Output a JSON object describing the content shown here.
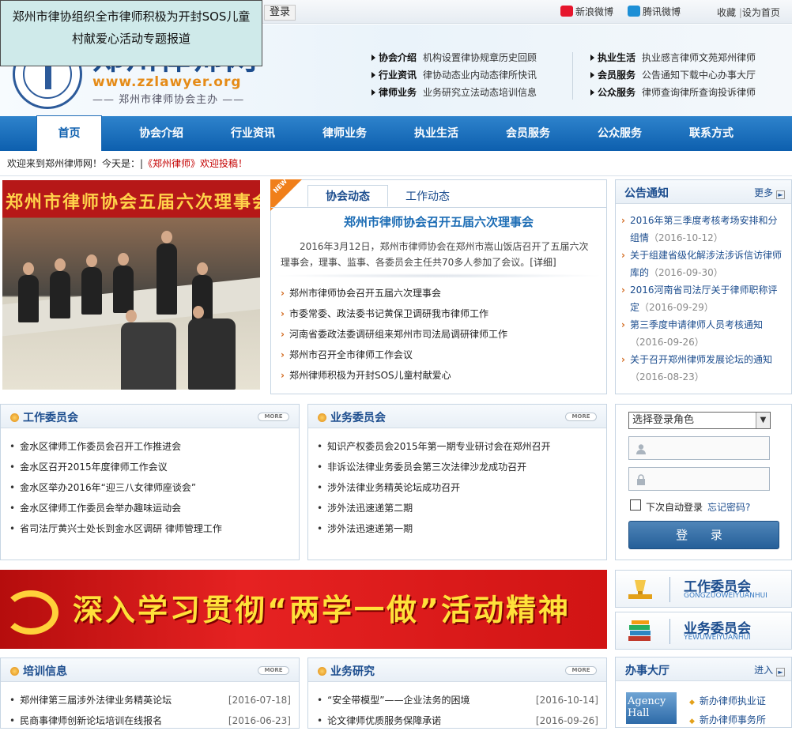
{
  "popup": {
    "text": "郑州市律协组织全市律师积极为开封SOS儿童村献爱心活动专题报道"
  },
  "topbar": {
    "login": "登录",
    "sina_weibo": "新浪微博",
    "tencent_weibo": "腾讯微博",
    "favorite": "收藏",
    "set_home": "设为首页",
    "separator": "|"
  },
  "logo": {
    "title": "郑州律师网",
    "url": "www.zzlawyer.org",
    "subtitle": "—— 郑州市律师协会主办 ——"
  },
  "header_nav": [
    {
      "title": "协会介绍",
      "links": [
        "机构设置",
        "律协规章",
        "历史回顾"
      ]
    },
    {
      "title": "行业资讯",
      "links": [
        "律协动态",
        "业内动态",
        "律所快讯"
      ]
    },
    {
      "title": "律师业务",
      "links": [
        "业务研究",
        "立法动态",
        "培训信息"
      ]
    },
    {
      "title": "执业生活",
      "links": [
        "执业感言",
        "律师文苑",
        "郑州律师"
      ]
    },
    {
      "title": "会员服务",
      "links": [
        "公告通知",
        "下载中心",
        "办事大厅"
      ]
    },
    {
      "title": "公众服务",
      "links": [
        "律师查询",
        "律所查询",
        "投诉律师"
      ]
    }
  ],
  "main_nav": [
    "首页",
    "协会介绍",
    "行业资讯",
    "律师业务",
    "执业生活",
    "会员服务",
    "公众服务",
    "联系方式"
  ],
  "welcome": {
    "text": "欢迎来到郑州律师网！今天是：|",
    "notice": "《郑州律师》欢迎投稿！"
  },
  "photo": {
    "banner": "郑州市律师协会五届六次理事会"
  },
  "news": {
    "badge": "NEW",
    "tab_active": "协会动态",
    "tab_other": "工作动态",
    "headline": "郑州市律师协会召开五届六次理事会",
    "summary": "2016年3月12日，郑州市律师协会在郑州市嵩山饭店召开了五届六次理事会，理事、监事、各委员会主任共70多人参加了会议。",
    "detail": "[详细]",
    "items": [
      "郑州市律师协会召开五届六次理事会",
      "市委常委、政法委书记黄保卫调研我市律师工作",
      "河南省委政法委调研组来郑州市司法局调研律师工作",
      "郑州市召开全市律师工作会议",
      "郑州律师积极为开封SOS儿童村献爱心"
    ]
  },
  "notice": {
    "title": "公告通知",
    "more": "更多",
    "items": [
      {
        "text": "2016年第三季度考核考场安排和分组情",
        "date": "（2016-10-12）"
      },
      {
        "text": "关于组建省级化解涉法涉诉信访律师库的",
        "date": "（2016-09-30）"
      },
      {
        "text": "2016河南省司法厅关于律师职称评定",
        "date": "（2016-09-29）"
      },
      {
        "text": "第三季度申请律师人员考核通知",
        "date": "（2016-09-26）"
      },
      {
        "text": "关于召开郑州律师发展论坛的通知",
        "date": "（2016-08-23）"
      }
    ]
  },
  "work_committee": {
    "title": "工作委员会",
    "more": "MORE",
    "items": [
      "金水区律师工作委员会召开工作推进会",
      "金水区召开2015年度律师工作会议",
      "金水区举办2016年“迎三八女律师座谈会”",
      "金水区律师工作委员会举办趣味运动会",
      "省司法厅黄兴士处长到金水区调研 律师管理工作"
    ]
  },
  "business_committee": {
    "title": "业务委员会",
    "more": "MORE",
    "items": [
      "知识产权委员会2015年第一期专业研讨会在郑州召开",
      "非诉讼法律业务委员会第三次法律沙龙成功召开",
      "涉外法律业务精英论坛成功召开",
      "涉外法迅速递第二期",
      "涉外法迅速递第一期"
    ]
  },
  "login": {
    "role": "选择登录角色",
    "auto_login": "下次自动登录",
    "forgot": "忘记密码?",
    "button": "登 录"
  },
  "banner": {
    "text": "深入学习贯彻“两学一做”活动精神"
  },
  "side_buttons": [
    {
      "cn": "工作委员会",
      "en": "GONGZUOWEIYUANHUI"
    },
    {
      "cn": "业务委员会",
      "en": "YEWUWEIYUANHUI"
    }
  ],
  "training": {
    "title": "培训信息",
    "more": "MORE",
    "items": [
      {
        "text": "郑州律第三届涉外法律业务精英论坛",
        "date": "[2016-07-18]"
      },
      {
        "text": "民商事律师创新论坛培训在线报名",
        "date": "[2016-06-23]"
      }
    ]
  },
  "research": {
    "title": "业务研究",
    "more": "MORE",
    "items": [
      {
        "text": "“安全带模型”——企业法务的困境",
        "date": "[2016-10-14]"
      },
      {
        "text": "论文律师优质服务保障承诺",
        "date": "[2016-09-26]"
      }
    ]
  },
  "hall": {
    "title": "办事大厅",
    "enter": "进入",
    "agency": "Agency Hall",
    "items": [
      "新办律师执业证",
      "新办律师事务所"
    ]
  },
  "colors": {
    "nav_blue": "#0d5fae",
    "accent_orange": "#f07f1a",
    "title_blue": "#1c4d8e",
    "banner_red": "#d11414"
  }
}
